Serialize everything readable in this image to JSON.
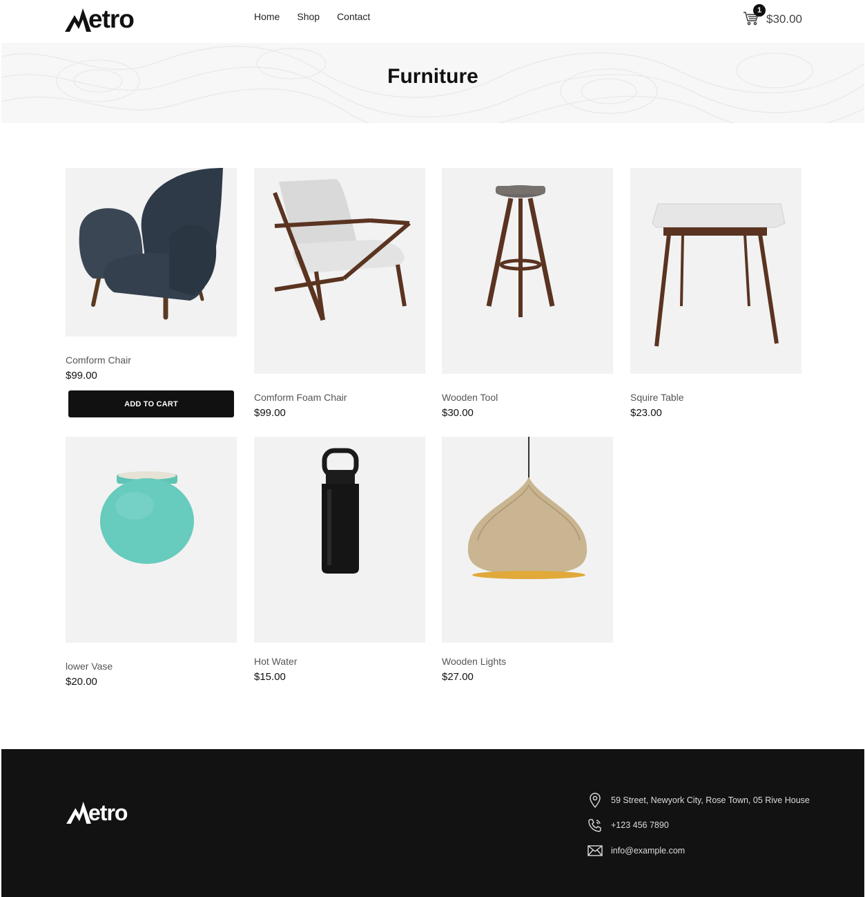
{
  "brand": {
    "name": "etro"
  },
  "nav": {
    "items": [
      "Home",
      "Shop",
      "Contact"
    ]
  },
  "cart": {
    "count": "1",
    "total": "$30.00"
  },
  "banner": {
    "title": "Furniture"
  },
  "products": [
    {
      "name": "Comform Chair",
      "price": "$99.00",
      "icon": "armchair-image"
    },
    {
      "name": "Comform Foam Chair",
      "price": "$99.00",
      "icon": "lounge-chair-image"
    },
    {
      "name": "Wooden Tool",
      "price": "$30.00",
      "icon": "bar-stool-image"
    },
    {
      "name": "Squire Table",
      "price": "$23.00",
      "icon": "side-table-image"
    },
    {
      "name": "lower Vase",
      "price": "$20.00",
      "icon": "vase-image"
    },
    {
      "name": "Hot Water",
      "price": "$15.00",
      "icon": "water-bottle-image"
    },
    {
      "name": "Wooden Lights",
      "price": "$27.00",
      "icon": "pendant-lamp-image"
    }
  ],
  "add_to_cart": {
    "label": "ADD TO CART"
  },
  "footer": {
    "address": "59 Street, Newyork City, Rose Town, 05 Rive House",
    "phone": "+123 456 7890",
    "email": "info@example.com"
  },
  "colors": {
    "dark": "#111111",
    "footer_bg": "#121212",
    "card_bg": "#f2f2f2",
    "banner_bg": "#f7f7f7"
  }
}
